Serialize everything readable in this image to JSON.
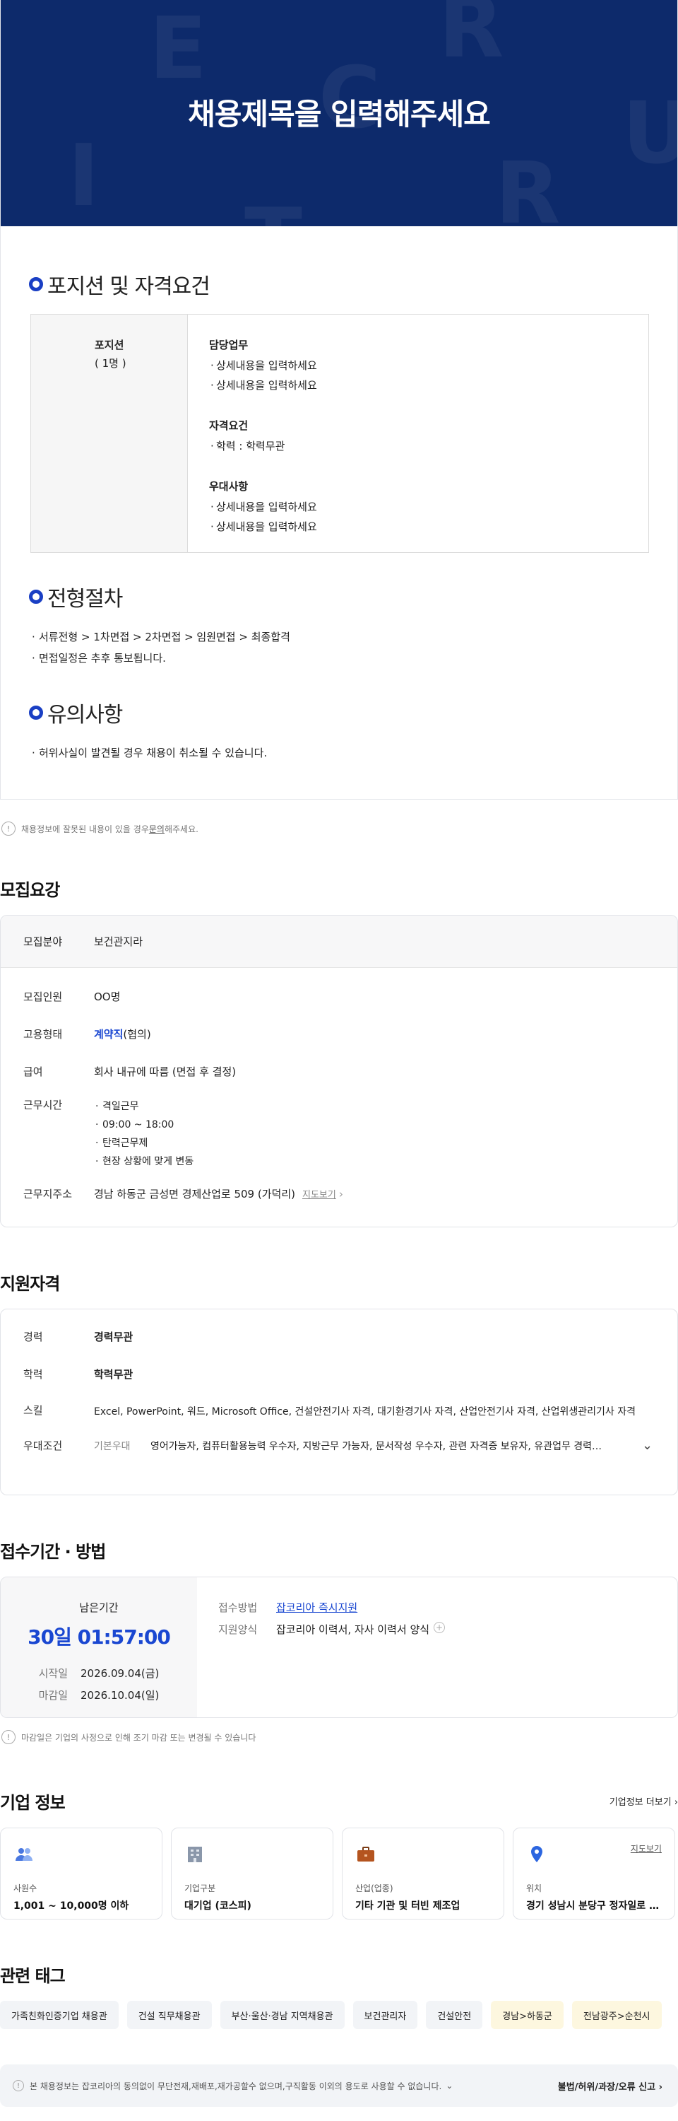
{
  "hero": {
    "title": "채용제목을 입력해주세요",
    "letters": [
      "E",
      "R",
      "C",
      "U",
      "I",
      "T",
      "R"
    ],
    "bg_color": "#0d2a6b"
  },
  "position_section": {
    "heading": "포지션 및 자격요건",
    "position_label": "포지션",
    "position_count": "( 1명 )",
    "groups": [
      {
        "title": "담당업무",
        "items": [
          "상세내용을 입력하세요",
          "상세내용을 입력하세요"
        ]
      },
      {
        "title": "자격요건",
        "items": [
          "학력 : 학력무관"
        ]
      },
      {
        "title": "우대사항",
        "items": [
          "상세내용을 입력하세요",
          "상세내용을 입력하세요"
        ]
      }
    ]
  },
  "process_section": {
    "heading": "전형절차",
    "items": [
      "서류전형 > 1차면접 > 2차면접 > 임원면접 > 최종합격",
      "면접일정은 추후 통보됩니다."
    ]
  },
  "notes_section": {
    "heading": "유의사항",
    "items": [
      "허위사실이 발견될 경우 채용이 취소될 수 있습니다."
    ]
  },
  "report_notice": {
    "pre": "채용정보에 잘못된 내용이 있을 경우 ",
    "link": "문의",
    "post": "해주세요."
  },
  "recruit": {
    "title": "모집요강",
    "field_key": "모집분야",
    "field_val": "보건관지라",
    "headcount_key": "모집인원",
    "headcount_val": "OO명",
    "type_key": "고용형태",
    "type_val": "계약직",
    "type_suffix": "(협의)",
    "salary_key": "급여",
    "salary_val": "회사 내규에 따름 (면접 후 결정)",
    "hours_key": "근무시간",
    "hours_items": [
      "격일근무",
      "09:00 ~ 18:00",
      "탄력근무제",
      "현장 상황에 맞게 변동"
    ],
    "address_key": "근무지주소",
    "address_val": "경남 하동군 금성면 경제산업로 509 (가덕리)",
    "map_link": "지도보기"
  },
  "qualification": {
    "title": "지원자격",
    "career_key": "경력",
    "career_val": "경력무관",
    "edu_key": "학력",
    "edu_val": "학력무관",
    "skill_key": "스킬",
    "skill_val": "Excel, PowerPoint, 워드, Microsoft Office, 건설안전기사 자격, 대기환경기사 자격, 산업안전기사 자격, 산업위생관리기사 자격",
    "pref_key": "우대조건",
    "pref_sub": "기본우대",
    "pref_val": "영어가능자, 컴퓨터활용능력 우수자, 지방근무 가능자, 문서작성 우수자, 관련 자격증 보유자, 유관업무 경력…"
  },
  "apply": {
    "title": "접수기간 · 방법",
    "remain_label": "남은기간",
    "remain_val": "30일 01:57:00",
    "start_key": "시작일",
    "start_val": "2026.09.04(금)",
    "end_key": "마감일",
    "end_val": "2026.10.04(일)",
    "method_key": "접수방법",
    "method_val": "잡코리아 즉시지원",
    "form_key": "지원양식",
    "form_val": "잡코리아 이력서, 자사 이력서 양식",
    "notice": "마감일은 기업의 사정으로 인해 조기 마감 또는 변경될 수 있습니다"
  },
  "company": {
    "title": "기업 정보",
    "more": "기업정보 더보기",
    "cards": [
      {
        "icon": "people-icon",
        "label": "사원수",
        "value": "1,001 ~ 10,000명 이하"
      },
      {
        "icon": "building-icon",
        "label": "기업구분",
        "value": "대기업 (코스피)"
      },
      {
        "icon": "briefcase-icon",
        "label": "산업(업종)",
        "value": "기타 기관 및 터빈 제조업"
      },
      {
        "icon": "location-pin-icon",
        "label": "위치",
        "value": "경기 성남시 분당구 정자일로 15…",
        "map": "지도보기"
      }
    ]
  },
  "tags": {
    "title": "관련 태그",
    "items": [
      {
        "text": "가족친화인증기업 채용관",
        "yellow": false
      },
      {
        "text": "건설 직무채용관",
        "yellow": false
      },
      {
        "text": "부산·울산·경남 지역채용관",
        "yellow": false
      },
      {
        "text": "보건관리자",
        "yellow": false
      },
      {
        "text": "건설안전",
        "yellow": false
      },
      {
        "text": "경남>하동군",
        "yellow": true
      },
      {
        "text": "전남광주>순천시",
        "yellow": true
      }
    ]
  },
  "footer": {
    "notice": "본 채용정보는 잡코리아의 동의없이 무단전재,재배포,재가공할수 없으며,구직활동 이외의 용도로 사용할 수 없습니다.",
    "report": "불법/허위/과장/오류 신고"
  },
  "colors": {
    "accent": "#1a47d1",
    "ring": "#1a3fc4"
  }
}
